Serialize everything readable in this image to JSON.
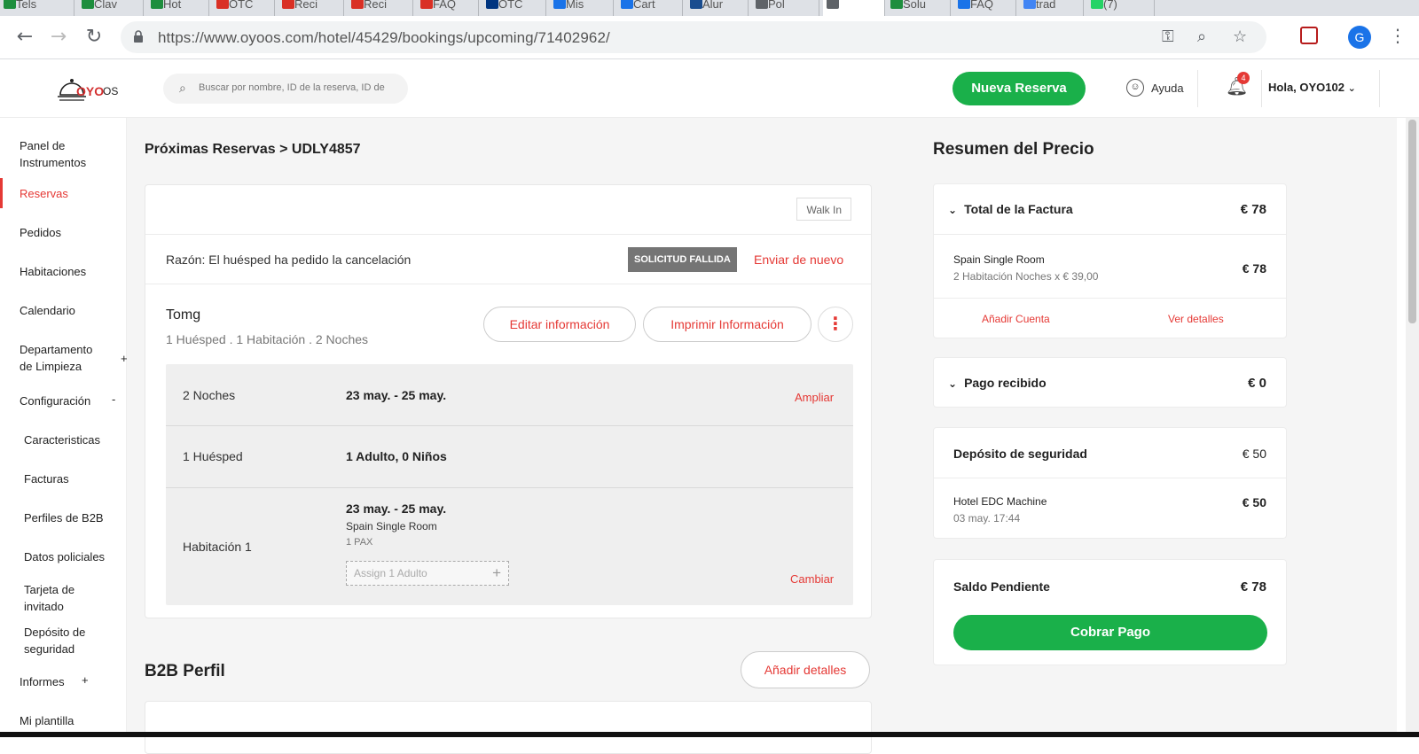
{
  "browser": {
    "tabs": [
      {
        "label": "Tels",
        "color": "#1e8e3e"
      },
      {
        "label": "Clav",
        "color": "#1e8e3e"
      },
      {
        "label": "Hot",
        "color": "#1e8e3e"
      },
      {
        "label": "OTC",
        "color": "#d93025"
      },
      {
        "label": "Reci",
        "color": "#d93025"
      },
      {
        "label": "Reci",
        "color": "#d93025"
      },
      {
        "label": "FAQ",
        "color": "#d93025"
      },
      {
        "label": "OTC",
        "color": "#003580"
      },
      {
        "label": "Mis",
        "color": "#1a73e8"
      },
      {
        "label": "Cart",
        "color": "#1a73e8"
      },
      {
        "label": "Alur",
        "color": "#1a4d8f"
      },
      {
        "label": "Pol",
        "color": "#5f6368"
      },
      {
        "label": "",
        "color": "#5f6368"
      },
      {
        "label": "Solu",
        "color": "#1e8e3e"
      },
      {
        "label": "FAQ",
        "color": "#1a73e8"
      },
      {
        "label": "trad",
        "color": "#4285f4"
      },
      {
        "label": "(7)",
        "color": "#25d366"
      }
    ],
    "url": "https://www.oyoos.com/hotel/45429/bookings/upcoming/71402962/",
    "profile_initial": "G"
  },
  "header": {
    "logo_oyo": "OYO",
    "logo_os": "OS",
    "search_placeholder": "Buscar por nombre, ID de la reserva, ID de",
    "new_booking": "Nueva Reserva",
    "help": "Ayuda",
    "notifications_count": "4",
    "user_greeting": "Hola, OYO102"
  },
  "sidebar": {
    "items": [
      {
        "label": "Panel de Instrumentos"
      },
      {
        "label": "Reservas",
        "active": true
      },
      {
        "label": "Pedidos"
      },
      {
        "label": "Habitaciones"
      },
      {
        "label": "Calendario"
      },
      {
        "label": "Departamento de Limpieza",
        "expander": "+"
      },
      {
        "label": "Configuración",
        "expander": "-"
      },
      {
        "label": "Caracteristicas"
      },
      {
        "label": "Facturas"
      },
      {
        "label": "Perfiles de B2B"
      },
      {
        "label": "Datos policiales"
      },
      {
        "label": "Tarjeta de invitado"
      },
      {
        "label": "Depósito de seguridad"
      },
      {
        "label": "Informes",
        "expander": "+"
      },
      {
        "label": "Mi plantilla"
      }
    ]
  },
  "booking": {
    "breadcrumb": "Próximas Reservas > UDLY4857",
    "walk_in": "Walk In",
    "reason": "Razón: El huésped ha pedido la cancelación",
    "status_badge": "SOLICITUD FALLIDA",
    "resend": "Enviar de nuevo",
    "guest_name": "Tomg",
    "guest_summary": "1 Huésped . 1 Habitación . 2 Noches",
    "edit_info": "Editar información",
    "print_info": "Imprimir Información",
    "nights_label": "2 Noches",
    "nights_value": "23 may. - 25 may.",
    "extend": "Ampliar",
    "guests_label": "1 Huésped",
    "guests_value": "1 Adulto, 0 Niños",
    "room_label": "Habitación 1",
    "room_dates": "23 may. - 25 may.",
    "room_type": "Spain Single Room",
    "room_pax": "1 PAX",
    "assign_placeholder": "Assign 1 Adulto",
    "change": "Cambiar"
  },
  "b2b": {
    "title": "B2B Perfil",
    "add_details": "Añadir detalles"
  },
  "price_summary": {
    "title": "Resumen del Precio",
    "invoice_total_label": "Total de la Factura",
    "invoice_total_value": "€ 78",
    "room_name": "Spain Single Room",
    "room_calc": "2 Habitación Noches x € 39,00",
    "room_value": "€ 78",
    "add_account": "Añadir Cuenta",
    "see_details": "Ver detalles",
    "payment_received_label": "Pago recibido",
    "payment_received_value": "€ 0",
    "deposit_label": "Depósito de seguridad",
    "deposit_value": "€ 50",
    "deposit_item": "Hotel EDC Machine",
    "deposit_date": "03 may. 17:44",
    "deposit_item_value": "€ 50",
    "pending_label": "Saldo Pendiente",
    "pending_value": "€ 78",
    "collect_payment": "Cobrar Pago"
  }
}
